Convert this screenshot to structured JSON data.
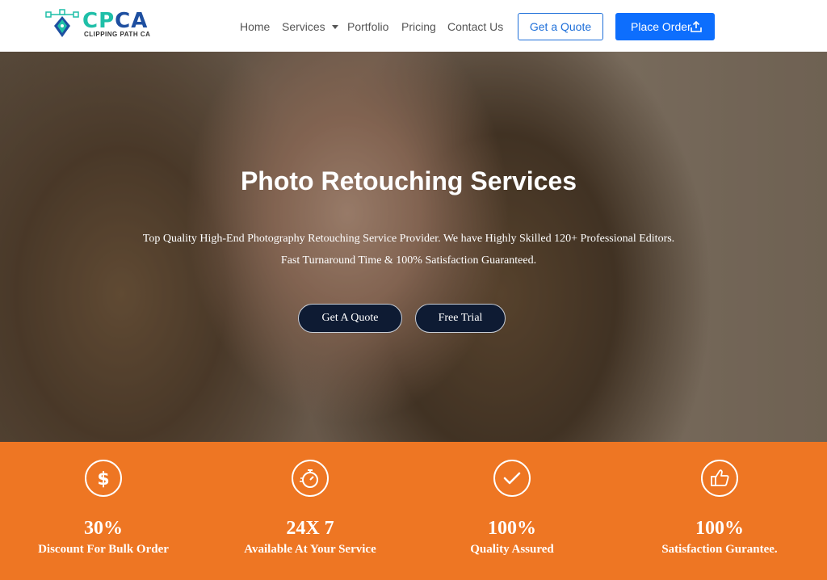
{
  "header": {
    "logo": {
      "text_cp": "CP",
      "text_ca": "CA",
      "subtitle": "CLIPPING PATH CA"
    },
    "nav": [
      {
        "label": "Home"
      },
      {
        "label": "Services"
      },
      {
        "label": "Portfolio"
      },
      {
        "label": "Pricing"
      },
      {
        "label": "Contact Us"
      }
    ],
    "quote_button": "Get a Quote",
    "order_button": "Place Order",
    "order_icon": "upload-icon"
  },
  "hero": {
    "title": "Photo Retouching Services",
    "line1": "Top Quality High-End Photography Retouching Service Provider. We have Highly Skilled 120+ Professional Editors.",
    "line2": "Fast Turnaround Time & 100% Satisfaction Guaranteed.",
    "buttons": [
      {
        "label": "Get A Quote"
      },
      {
        "label": "Free Trial"
      }
    ]
  },
  "features": [
    {
      "icon": "dollar-icon",
      "value": "30%",
      "label": "Discount For Bulk Order"
    },
    {
      "icon": "stopwatch-icon",
      "value": "24X 7",
      "label": "Available At Your Service"
    },
    {
      "icon": "checkmark-icon",
      "value": "100%",
      "label": "Quality Assured"
    },
    {
      "icon": "thumbs-up-icon",
      "value": "100%",
      "label": "Satisfaction Gurantee."
    }
  ],
  "colors": {
    "accent_blue": "#0d6efd",
    "features_orange": "#ee7623",
    "hero_button_navy": "#0e1b33"
  }
}
